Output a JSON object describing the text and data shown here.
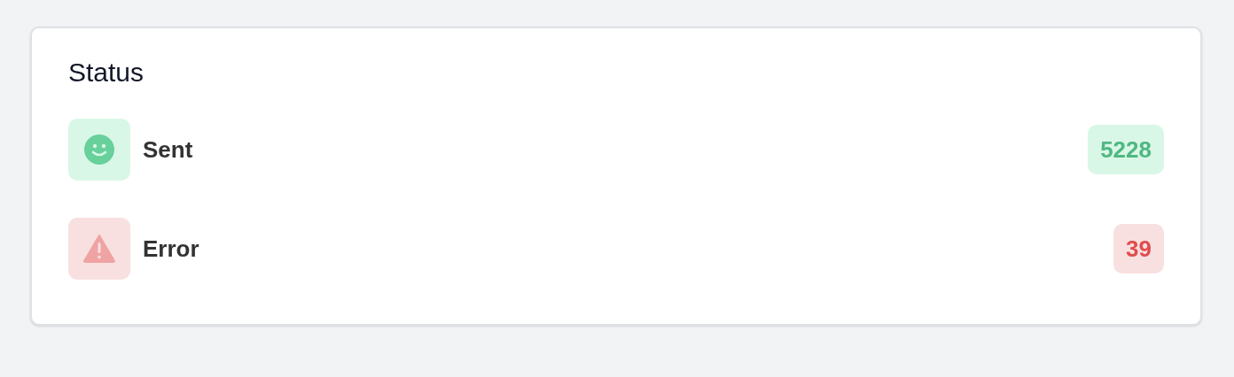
{
  "card": {
    "title": "Status"
  },
  "items": [
    {
      "kind": "success",
      "label": "Sent",
      "count": "5228"
    },
    {
      "kind": "error",
      "label": "Error",
      "count": "39"
    }
  ]
}
